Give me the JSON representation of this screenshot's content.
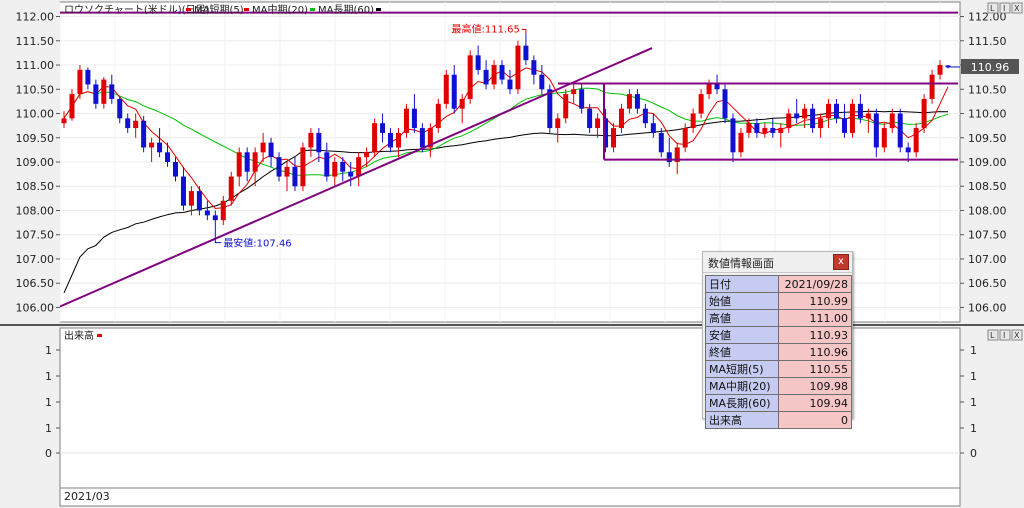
{
  "legend": {
    "chart_name": "ロウソクチャート(米ドル)(日足)",
    "ma_short": "MA短期(5)",
    "ma_mid": "MA中期(20)",
    "ma_long": "MA長期(60)"
  },
  "price_axis": {
    "labels": [
      "112.00",
      "111.50",
      "111.00",
      "110.50",
      "110.00",
      "109.50",
      "109.00",
      "108.50",
      "108.00",
      "107.50",
      "107.00",
      "106.50",
      "106.00"
    ],
    "current_price": "110.96"
  },
  "annotations": {
    "high": "最高値:111.65",
    "low": "最安値:107.46"
  },
  "volume_panel": {
    "title": "出来高",
    "axis_labels": [
      "1",
      "1",
      "1",
      "1",
      "0"
    ]
  },
  "time_axis": {
    "label": "2021/03"
  },
  "panel_buttons": {
    "left": "L",
    "right": "I",
    "close": "X"
  },
  "info_panel": {
    "title": "数値情報画面",
    "close": "x",
    "rows": [
      {
        "label": "日付",
        "value": "2021/09/28"
      },
      {
        "label": "始値",
        "value": "110.99"
      },
      {
        "label": "高値",
        "value": "111.00"
      },
      {
        "label": "安値",
        "value": "110.93"
      },
      {
        "label": "終値",
        "value": "110.96"
      },
      {
        "label": "MA短期(5)",
        "value": "110.55"
      },
      {
        "label": "MA中期(20)",
        "value": "109.98"
      },
      {
        "label": "MA長期(60)",
        "value": "109.94"
      },
      {
        "label": "出来高",
        "value": "0"
      }
    ]
  },
  "colors": {
    "bull": "#e00000",
    "bear": "#1010d0",
    "ma_short": "#e00000",
    "ma_mid": "#00c000",
    "ma_long": "#000000",
    "trendline": "#800080"
  },
  "chart_data": {
    "type": "candlestick",
    "title": "ロウソクチャート(米ドル)(日足)",
    "ylim": [
      105.7,
      112.3
    ],
    "start_label": "2021/03",
    "extremes": {
      "high": 111.65,
      "low": 107.46
    },
    "candles": [
      [
        109.8,
        110.05,
        109.7,
        109.9
      ],
      [
        109.9,
        110.5,
        109.85,
        110.4
      ],
      [
        110.4,
        111.0,
        110.3,
        110.9
      ],
      [
        110.9,
        110.95,
        110.5,
        110.6
      ],
      [
        110.6,
        110.7,
        110.1,
        110.2
      ],
      [
        110.2,
        110.75,
        110.1,
        110.7
      ],
      [
        110.6,
        110.8,
        110.2,
        110.3
      ],
      [
        110.3,
        110.35,
        109.8,
        109.9
      ],
      [
        109.9,
        110.0,
        109.6,
        109.7
      ],
      [
        109.7,
        110.0,
        109.5,
        109.85
      ],
      [
        109.85,
        109.95,
        109.2,
        109.3
      ],
      [
        109.3,
        109.5,
        109.0,
        109.4
      ],
      [
        109.4,
        109.7,
        109.1,
        109.2
      ],
      [
        109.2,
        109.4,
        108.9,
        109.0
      ],
      [
        109.0,
        109.1,
        108.6,
        108.7
      ],
      [
        108.7,
        108.9,
        108.0,
        108.1
      ],
      [
        108.1,
        108.5,
        107.9,
        108.4
      ],
      [
        108.4,
        108.5,
        107.9,
        108.0
      ],
      [
        108.0,
        108.2,
        107.8,
        107.9
      ],
      [
        107.9,
        108.0,
        107.46,
        107.8
      ],
      [
        107.8,
        108.3,
        107.7,
        108.2
      ],
      [
        108.2,
        108.8,
        108.1,
        108.7
      ],
      [
        108.7,
        109.3,
        108.5,
        109.2
      ],
      [
        109.2,
        109.3,
        108.6,
        108.8
      ],
      [
        108.8,
        109.3,
        108.5,
        109.2
      ],
      [
        109.2,
        109.6,
        109.0,
        109.4
      ],
      [
        109.4,
        109.5,
        108.9,
        109.1
      ],
      [
        109.1,
        109.2,
        108.6,
        108.7
      ],
      [
        108.7,
        109.0,
        108.4,
        108.9
      ],
      [
        108.9,
        109.1,
        108.4,
        108.5
      ],
      [
        108.5,
        109.4,
        108.4,
        109.3
      ],
      [
        109.3,
        109.7,
        109.1,
        109.6
      ],
      [
        109.6,
        109.7,
        109.0,
        109.2
      ],
      [
        109.2,
        109.4,
        108.6,
        108.7
      ],
      [
        108.7,
        109.1,
        108.5,
        109.0
      ],
      [
        109.0,
        109.1,
        108.6,
        108.8
      ],
      [
        108.8,
        109.0,
        108.5,
        108.7
      ],
      [
        108.7,
        109.2,
        108.5,
        109.1
      ],
      [
        109.1,
        109.3,
        108.9,
        109.2
      ],
      [
        109.2,
        109.9,
        109.1,
        109.8
      ],
      [
        109.8,
        110.0,
        109.4,
        109.6
      ],
      [
        109.6,
        109.7,
        109.2,
        109.3
      ],
      [
        109.3,
        109.7,
        109.1,
        109.6
      ],
      [
        109.6,
        110.2,
        109.5,
        110.1
      ],
      [
        110.1,
        110.4,
        109.6,
        109.7
      ],
      [
        109.7,
        109.8,
        109.2,
        109.3
      ],
      [
        109.3,
        109.8,
        109.1,
        109.7
      ],
      [
        109.7,
        110.3,
        109.6,
        110.2
      ],
      [
        110.2,
        110.9,
        110.1,
        110.8
      ],
      [
        110.8,
        111.0,
        110.0,
        110.1
      ],
      [
        110.1,
        110.4,
        109.8,
        110.3
      ],
      [
        110.3,
        111.3,
        110.2,
        111.2
      ],
      [
        111.2,
        111.4,
        110.8,
        110.9
      ],
      [
        110.9,
        111.1,
        110.5,
        110.6
      ],
      [
        110.6,
        111.1,
        110.5,
        111.0
      ],
      [
        111.0,
        111.1,
        110.6,
        110.7
      ],
      [
        110.7,
        110.9,
        110.4,
        110.5
      ],
      [
        110.5,
        111.5,
        110.4,
        111.4
      ],
      [
        111.4,
        111.65,
        111.0,
        111.1
      ],
      [
        111.1,
        111.2,
        110.6,
        110.8
      ],
      [
        110.8,
        111.0,
        110.4,
        110.5
      ],
      [
        110.5,
        110.6,
        109.6,
        109.7
      ],
      [
        109.7,
        110.0,
        109.4,
        109.9
      ],
      [
        109.9,
        110.5,
        109.8,
        110.4
      ],
      [
        110.4,
        110.6,
        110.2,
        110.5
      ],
      [
        110.5,
        110.6,
        110.0,
        110.1
      ],
      [
        110.1,
        110.2,
        109.6,
        109.7
      ],
      [
        109.7,
        110.0,
        109.5,
        109.9
      ],
      [
        109.9,
        110.1,
        109.2,
        109.3
      ],
      [
        109.3,
        109.8,
        109.2,
        109.7
      ],
      [
        109.7,
        110.2,
        109.6,
        110.1
      ],
      [
        110.1,
        110.5,
        110.0,
        110.4
      ],
      [
        110.4,
        110.5,
        110.0,
        110.1
      ],
      [
        110.1,
        110.2,
        109.7,
        109.8
      ],
      [
        109.8,
        110.0,
        109.5,
        109.6
      ],
      [
        109.6,
        109.7,
        109.1,
        109.2
      ],
      [
        109.2,
        109.5,
        108.9,
        109.0
      ],
      [
        109.0,
        109.4,
        108.75,
        109.3
      ],
      [
        109.3,
        109.8,
        109.2,
        109.7
      ],
      [
        109.7,
        110.1,
        109.6,
        110.0
      ],
      [
        110.0,
        110.5,
        109.9,
        110.4
      ],
      [
        110.4,
        110.7,
        110.3,
        110.6
      ],
      [
        110.6,
        110.8,
        110.4,
        110.5
      ],
      [
        110.5,
        110.6,
        109.8,
        109.9
      ],
      [
        109.9,
        110.0,
        109.0,
        109.2
      ],
      [
        109.2,
        109.7,
        109.1,
        109.6
      ],
      [
        109.6,
        109.9,
        109.5,
        109.8
      ],
      [
        109.8,
        109.9,
        109.5,
        109.6
      ],
      [
        109.6,
        109.8,
        109.5,
        109.7
      ],
      [
        109.7,
        109.9,
        109.5,
        109.6
      ],
      [
        109.6,
        109.8,
        109.3,
        109.7
      ],
      [
        109.7,
        110.1,
        109.6,
        110.0
      ],
      [
        110.0,
        110.3,
        109.8,
        109.9
      ],
      [
        109.9,
        110.2,
        109.7,
        110.1
      ],
      [
        110.1,
        110.2,
        109.6,
        109.7
      ],
      [
        109.7,
        110.0,
        109.5,
        109.9
      ],
      [
        109.9,
        110.3,
        109.7,
        110.2
      ],
      [
        110.2,
        110.3,
        109.8,
        109.9
      ],
      [
        109.9,
        110.2,
        109.5,
        109.6
      ],
      [
        109.6,
        110.3,
        109.5,
        110.2
      ],
      [
        110.2,
        110.4,
        109.8,
        109.9
      ],
      [
        109.9,
        110.1,
        109.6,
        110.0
      ],
      [
        110.0,
        110.1,
        109.1,
        109.3
      ],
      [
        109.3,
        109.8,
        109.2,
        109.7
      ],
      [
        109.7,
        110.1,
        109.6,
        110.0
      ],
      [
        110.0,
        110.1,
        109.2,
        109.3
      ],
      [
        109.3,
        109.4,
        109.0,
        109.2
      ],
      [
        109.2,
        109.8,
        109.1,
        109.7
      ],
      [
        109.7,
        110.4,
        109.6,
        110.3
      ],
      [
        110.3,
        110.9,
        110.2,
        110.8
      ],
      [
        110.8,
        111.1,
        110.7,
        111.0
      ],
      [
        110.99,
        111.0,
        110.93,
        110.96
      ]
    ]
  }
}
